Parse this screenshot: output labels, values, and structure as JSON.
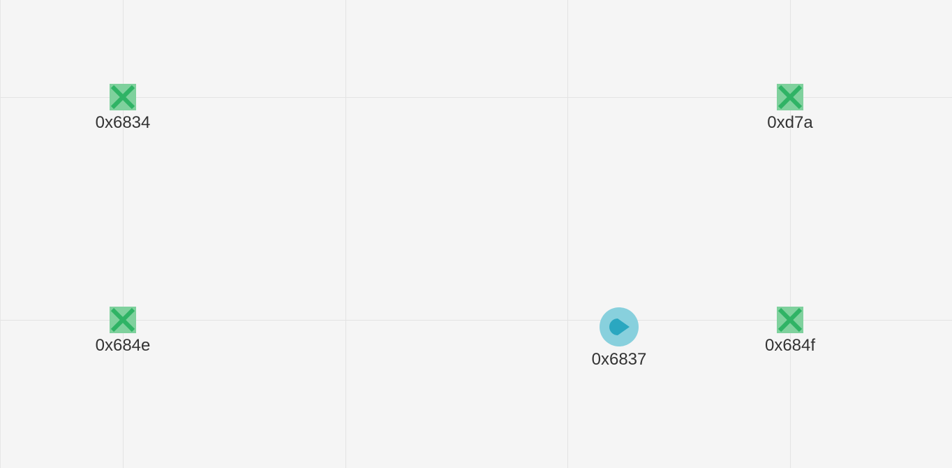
{
  "colors": {
    "background": "#f5f5f5",
    "grid_line": "#e3e3e3",
    "anchor_fill": "#7fd19d",
    "anchor_cross": "#2fb365",
    "robot_halo": "#88d0dd",
    "robot_body": "#2aa7c0",
    "label_text": "#333333"
  },
  "map": {
    "anchors": [
      {
        "id": "0x6834",
        "icon": "anchor-cross-icon"
      },
      {
        "id": "0xd7a",
        "icon": "anchor-cross-icon"
      },
      {
        "id": "0x684e",
        "icon": "anchor-cross-icon"
      },
      {
        "id": "0x684f",
        "icon": "anchor-cross-icon"
      }
    ],
    "tags": [
      {
        "id": "0x6837",
        "icon": "tag-heading-icon"
      }
    ]
  }
}
